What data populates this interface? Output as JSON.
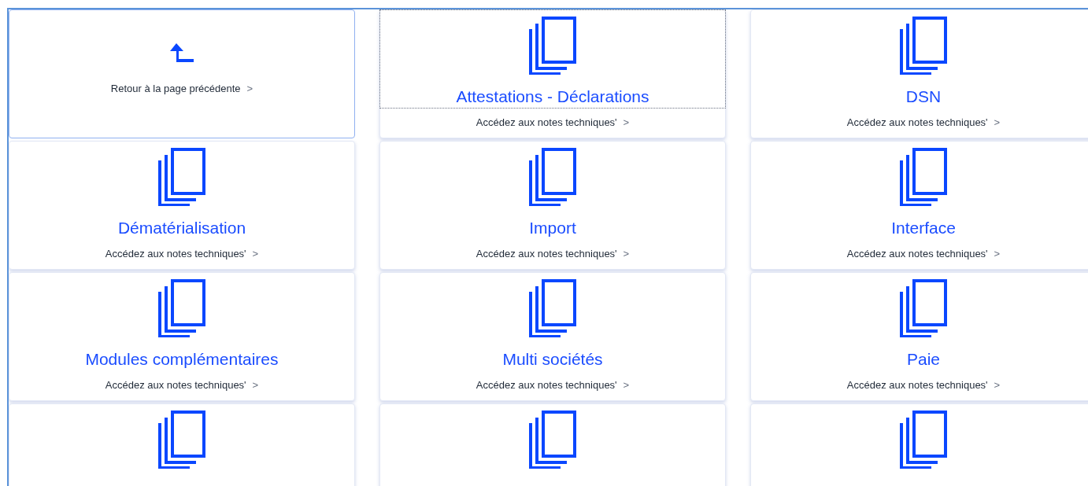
{
  "back_card": {
    "label": "Retour à la page précédente",
    "chevron": ">"
  },
  "cards": [
    {
      "title": "Attestations - Déclarations",
      "link": "Accédez aux notes techniques'",
      "chevron": ">",
      "focused": true
    },
    {
      "title": "DSN",
      "link": "Accédez aux notes techniques'",
      "chevron": ">",
      "focused": false
    },
    {
      "title": "Dématérialisation",
      "link": "Accédez aux notes techniques'",
      "chevron": ">",
      "focused": false
    },
    {
      "title": "Import",
      "link": "Accédez aux notes techniques'",
      "chevron": ">",
      "focused": false
    },
    {
      "title": "Interface",
      "link": "Accédez aux notes techniques'",
      "chevron": ">",
      "focused": false
    },
    {
      "title": "Modules complémentaires",
      "link": "Accédez aux notes techniques'",
      "chevron": ">",
      "focused": false
    },
    {
      "title": "Multi sociétés",
      "link": "Accédez aux notes techniques'",
      "chevron": ">",
      "focused": false
    },
    {
      "title": "Paie",
      "link": "Accédez aux notes techniques'",
      "chevron": ">",
      "focused": false
    },
    {
      "focused": false
    },
    {
      "focused": false
    },
    {
      "focused": false
    }
  ]
}
